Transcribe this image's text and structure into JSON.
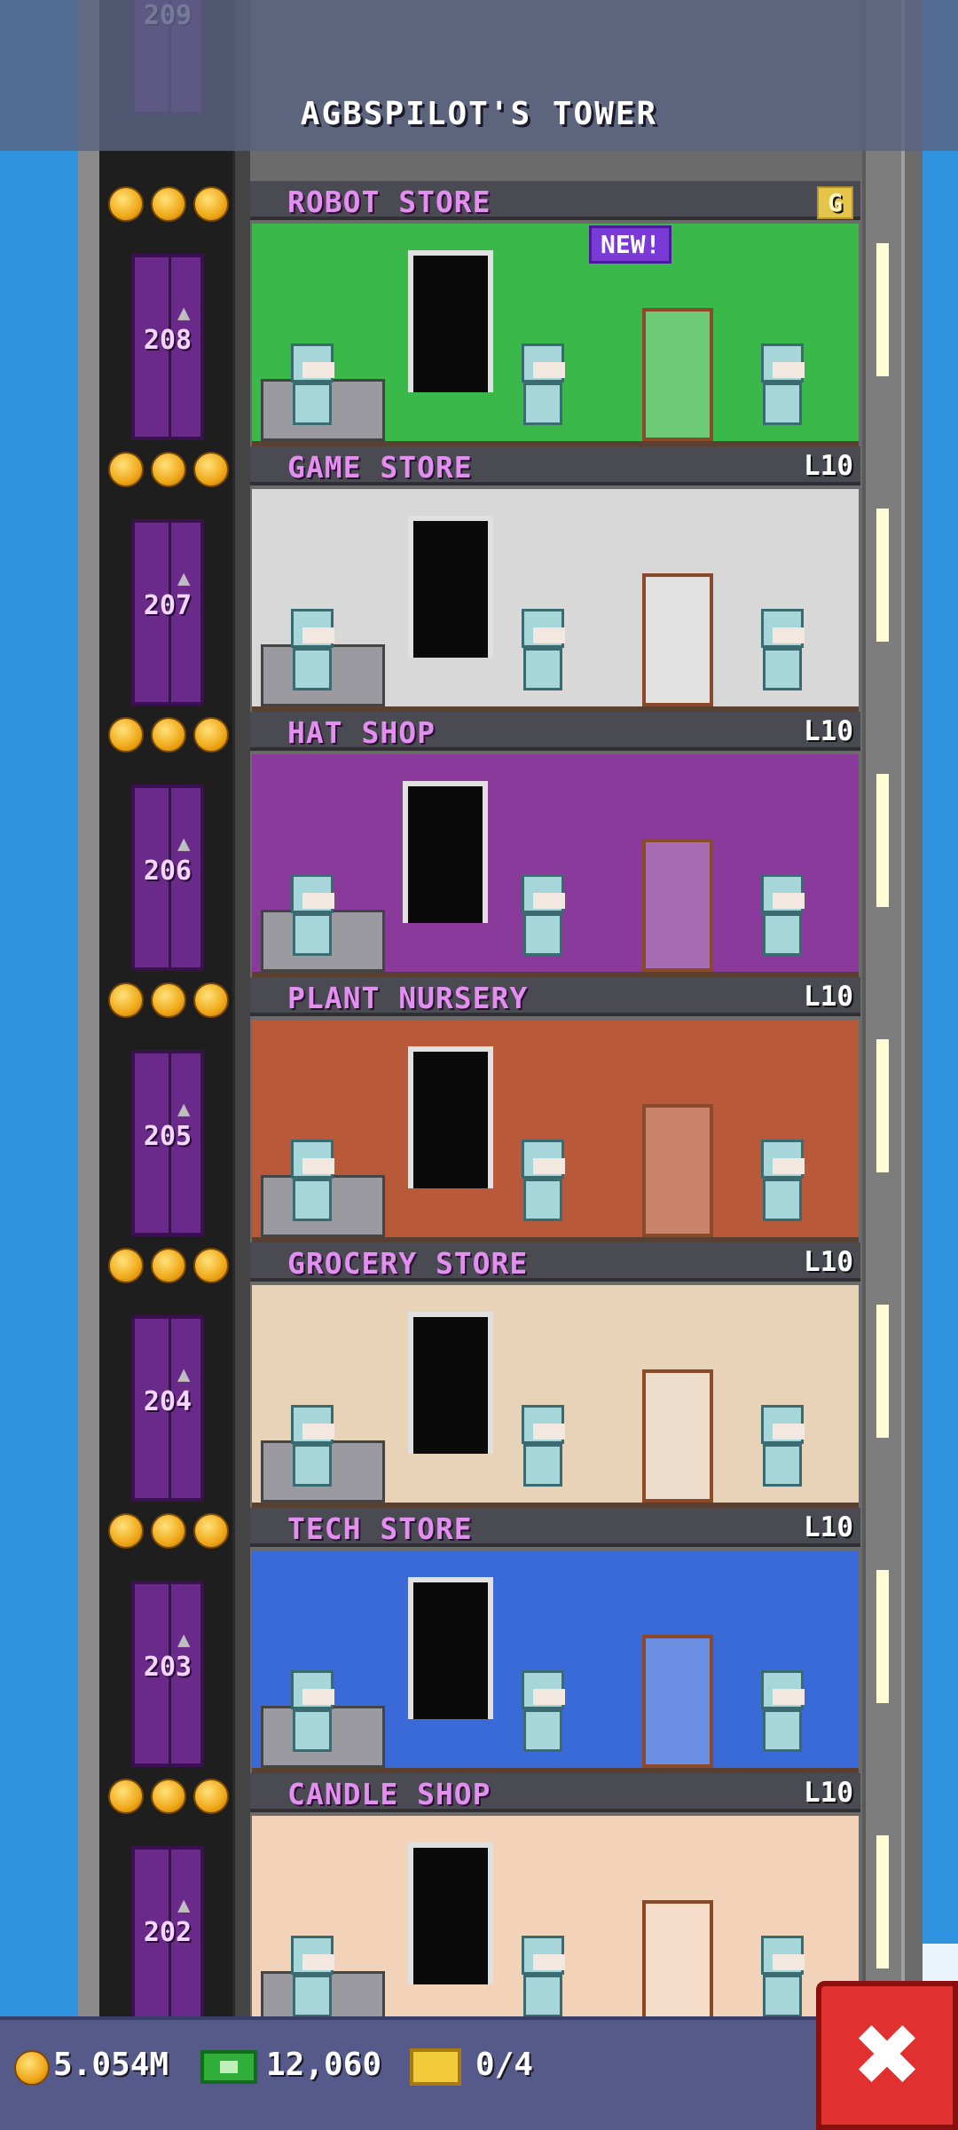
{
  "header": {
    "title": "AGBSPILOT'S TOWER"
  },
  "top_elevator": {
    "number": "209"
  },
  "floors": [
    {
      "name": "ROBOT STORE",
      "level": "G",
      "elevator": "208",
      "room_color": "#3bb84a",
      "badge": "NEW!"
    },
    {
      "name": "GAME STORE",
      "level": "L10",
      "elevator": "207",
      "room_color": "#d8d8d8"
    },
    {
      "name": "HAT SHOP",
      "level": "L10",
      "elevator": "206",
      "room_color": "#8a3a9a"
    },
    {
      "name": "PLANT NURSERY",
      "level": "L10",
      "elevator": "205",
      "room_color": "#b85a3a"
    },
    {
      "name": "GROCERY STORE",
      "level": "L10",
      "elevator": "204",
      "room_color": "#e8d2b8"
    },
    {
      "name": "TECH STORE",
      "level": "L10",
      "elevator": "203",
      "room_color": "#3a6ad8"
    },
    {
      "name": "CANDLE SHOP",
      "level": "L10",
      "elevator": "202",
      "room_color": "#f2d2b8"
    }
  ],
  "bottom": {
    "coins": "5.054M",
    "bux": "12,060",
    "tickets": "0/4",
    "close_symbol": "✖"
  }
}
